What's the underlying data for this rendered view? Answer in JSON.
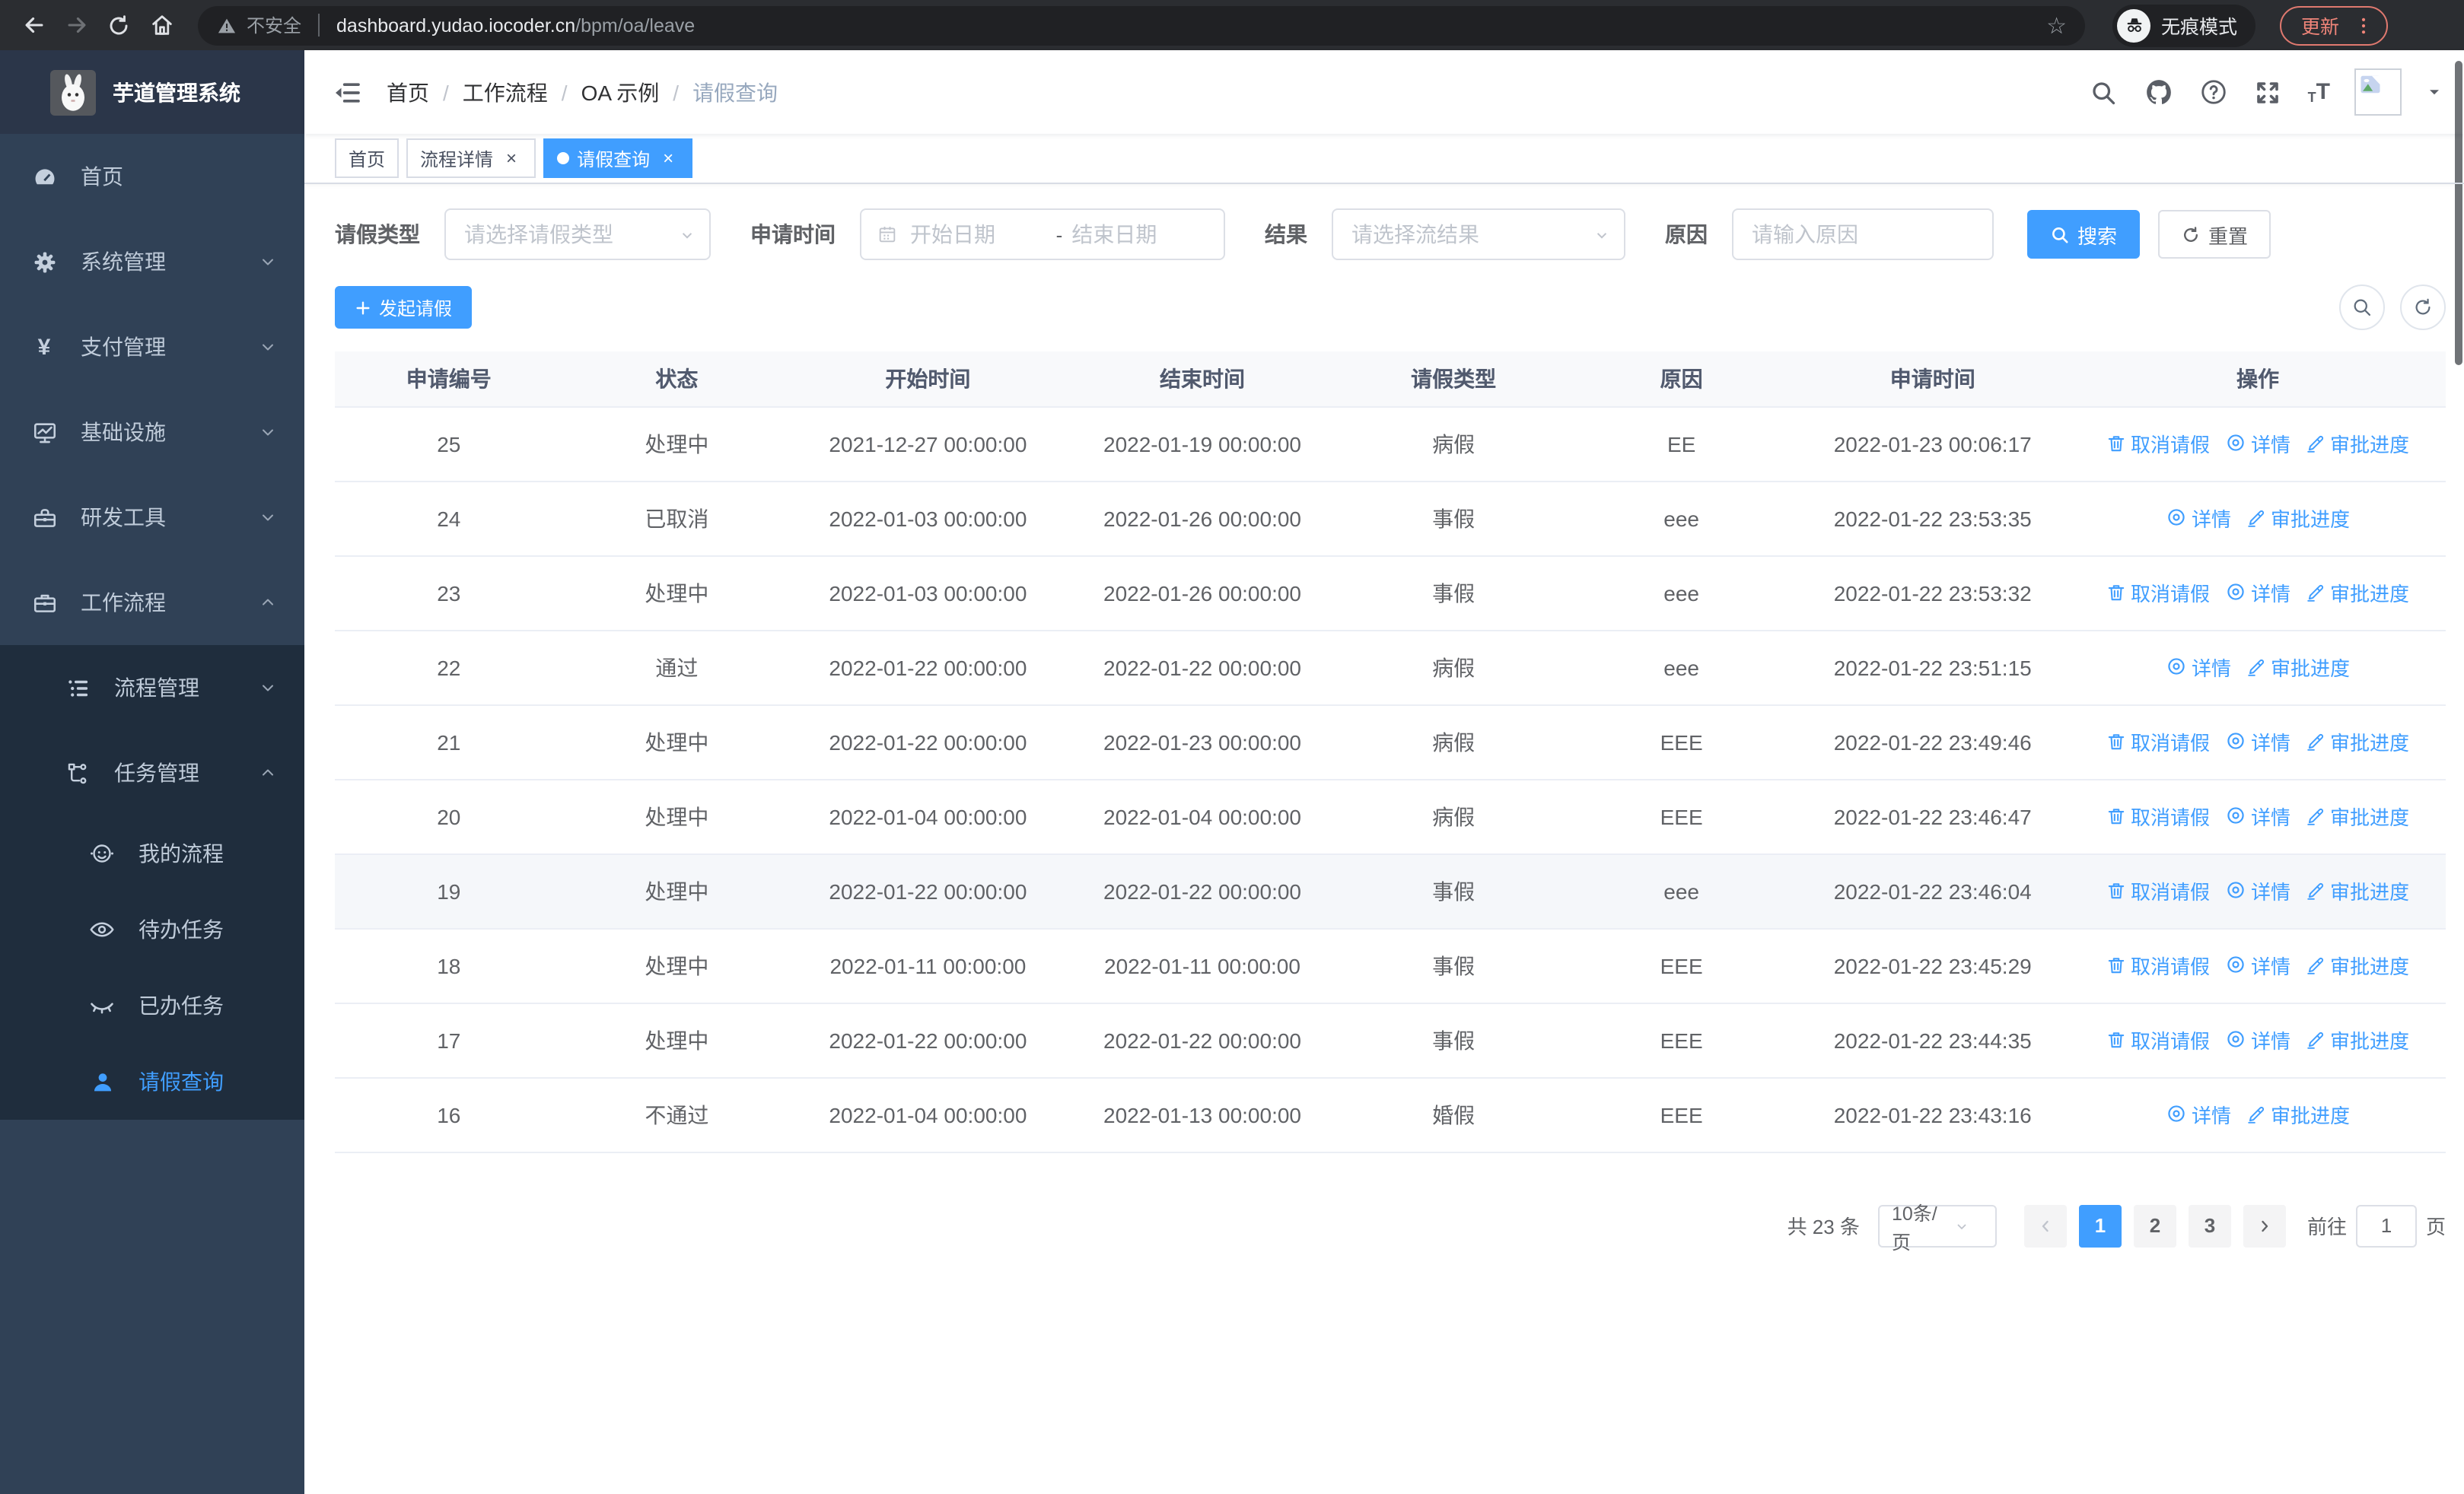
{
  "colors": {
    "primary": "#409EFF",
    "sidebar_bg": "#304156",
    "submenu_bg": "#1f2d3d",
    "update_accent": "#f08579"
  },
  "browser": {
    "insecure": "不安全",
    "host": "dashboard.yudao.iocoder.cn",
    "path": "/bpm/oa/leave",
    "incognito": "无痕模式",
    "update": "更新"
  },
  "sidebar": {
    "title": "芋道管理系统",
    "items": [
      {
        "key": "home",
        "label": "首页",
        "icon": "gauge-icon",
        "level": 0
      },
      {
        "key": "system",
        "label": "系统管理",
        "icon": "gear-icon",
        "chevron": "down",
        "level": 0
      },
      {
        "key": "payment",
        "label": "支付管理",
        "icon": "yen-icon",
        "chevron": "down",
        "level": 0
      },
      {
        "key": "infra",
        "label": "基础设施",
        "icon": "monitor-icon",
        "chevron": "down",
        "level": 0
      },
      {
        "key": "devtools",
        "label": "研发工具",
        "icon": "toolbox-icon",
        "chevron": "down",
        "level": 0
      },
      {
        "key": "workflow",
        "label": "工作流程",
        "icon": "briefcase-icon",
        "chevron": "up",
        "level": 0
      },
      {
        "key": "process-mgmt",
        "label": "流程管理",
        "icon": "list-icon",
        "chevron": "down",
        "level": 1
      },
      {
        "key": "task-mgmt",
        "label": "任务管理",
        "icon": "tree-icon",
        "chevron": "up",
        "level": 1
      },
      {
        "key": "my-process",
        "label": "我的流程",
        "icon": "robot-icon",
        "level": 2
      },
      {
        "key": "todo-tasks",
        "label": "待办任务",
        "icon": "eye-open-icon",
        "level": 2
      },
      {
        "key": "done-tasks",
        "label": "已办任务",
        "icon": "eye-closed-icon",
        "level": 2
      },
      {
        "key": "leave-query",
        "label": "请假查询",
        "icon": "user-icon",
        "level": 2,
        "active": true
      }
    ]
  },
  "nav": {
    "breadcrumb": [
      "首页",
      "工作流程",
      "OA 示例",
      "请假查询"
    ]
  },
  "tabs": [
    {
      "key": "home",
      "label": "首页",
      "closable": false,
      "active": false
    },
    {
      "key": "process-detail",
      "label": "流程详情",
      "closable": true,
      "active": false
    },
    {
      "key": "leave-query",
      "label": "请假查询",
      "closable": true,
      "active": true
    }
  ],
  "filters": {
    "type_label": "请假类型",
    "type_placeholder": "请选择请假类型",
    "time_label": "申请时间",
    "start_placeholder": "开始日期",
    "range_separator": "-",
    "end_placeholder": "结束日期",
    "result_label": "结果",
    "result_placeholder": "请选择流结果",
    "reason_label": "原因",
    "reason_placeholder": "请输入原因",
    "search": "搜索",
    "reset": "重置"
  },
  "toolbar": {
    "create": "发起请假"
  },
  "table": {
    "columns": [
      "申请编号",
      "状态",
      "开始时间",
      "结束时间",
      "请假类型",
      "原因",
      "申请时间",
      "操作"
    ],
    "action_defs": {
      "cancel": {
        "label": "取消请假",
        "icon": "trash-icon"
      },
      "detail": {
        "label": "详情",
        "icon": "view-icon"
      },
      "progress": {
        "label": "审批进度",
        "icon": "pen-icon"
      }
    },
    "rows": [
      {
        "id": "25",
        "status": "处理中",
        "start": "2021-12-27 00:00:00",
        "end": "2022-01-19 00:00:00",
        "type": "病假",
        "reason": "EE",
        "apply": "2022-01-23 00:06:17",
        "actions": [
          "cancel",
          "detail",
          "progress"
        ],
        "highlight": false
      },
      {
        "id": "24",
        "status": "已取消",
        "start": "2022-01-03 00:00:00",
        "end": "2022-01-26 00:00:00",
        "type": "事假",
        "reason": "eee",
        "apply": "2022-01-22 23:53:35",
        "actions": [
          "detail",
          "progress"
        ],
        "highlight": false
      },
      {
        "id": "23",
        "status": "处理中",
        "start": "2022-01-03 00:00:00",
        "end": "2022-01-26 00:00:00",
        "type": "事假",
        "reason": "eee",
        "apply": "2022-01-22 23:53:32",
        "actions": [
          "cancel",
          "detail",
          "progress"
        ],
        "highlight": false
      },
      {
        "id": "22",
        "status": "通过",
        "start": "2022-01-22 00:00:00",
        "end": "2022-01-22 00:00:00",
        "type": "病假",
        "reason": "eee",
        "apply": "2022-01-22 23:51:15",
        "actions": [
          "detail",
          "progress"
        ],
        "highlight": false
      },
      {
        "id": "21",
        "status": "处理中",
        "start": "2022-01-22 00:00:00",
        "end": "2022-01-23 00:00:00",
        "type": "病假",
        "reason": "EEE",
        "apply": "2022-01-22 23:49:46",
        "actions": [
          "cancel",
          "detail",
          "progress"
        ],
        "highlight": false
      },
      {
        "id": "20",
        "status": "处理中",
        "start": "2022-01-04 00:00:00",
        "end": "2022-01-04 00:00:00",
        "type": "病假",
        "reason": "EEE",
        "apply": "2022-01-22 23:46:47",
        "actions": [
          "cancel",
          "detail",
          "progress"
        ],
        "highlight": false
      },
      {
        "id": "19",
        "status": "处理中",
        "start": "2022-01-22 00:00:00",
        "end": "2022-01-22 00:00:00",
        "type": "事假",
        "reason": "eee",
        "apply": "2022-01-22 23:46:04",
        "actions": [
          "cancel",
          "detail",
          "progress"
        ],
        "highlight": true
      },
      {
        "id": "18",
        "status": "处理中",
        "start": "2022-01-11 00:00:00",
        "end": "2022-01-11 00:00:00",
        "type": "事假",
        "reason": "EEE",
        "apply": "2022-01-22 23:45:29",
        "actions": [
          "cancel",
          "detail",
          "progress"
        ],
        "highlight": false
      },
      {
        "id": "17",
        "status": "处理中",
        "start": "2022-01-22 00:00:00",
        "end": "2022-01-22 00:00:00",
        "type": "事假",
        "reason": "EEE",
        "apply": "2022-01-22 23:44:35",
        "actions": [
          "cancel",
          "detail",
          "progress"
        ],
        "highlight": false
      },
      {
        "id": "16",
        "status": "不通过",
        "start": "2022-01-04 00:00:00",
        "end": "2022-01-13 00:00:00",
        "type": "婚假",
        "reason": "EEE",
        "apply": "2022-01-22 23:43:16",
        "actions": [
          "detail",
          "progress"
        ],
        "highlight": false
      }
    ]
  },
  "pagination": {
    "total": "共 23 条",
    "page_size": "10条/页",
    "pages": [
      "1",
      "2",
      "3"
    ],
    "active_page": "1",
    "goto": "前往",
    "goto_value": "1",
    "unit": "页"
  }
}
